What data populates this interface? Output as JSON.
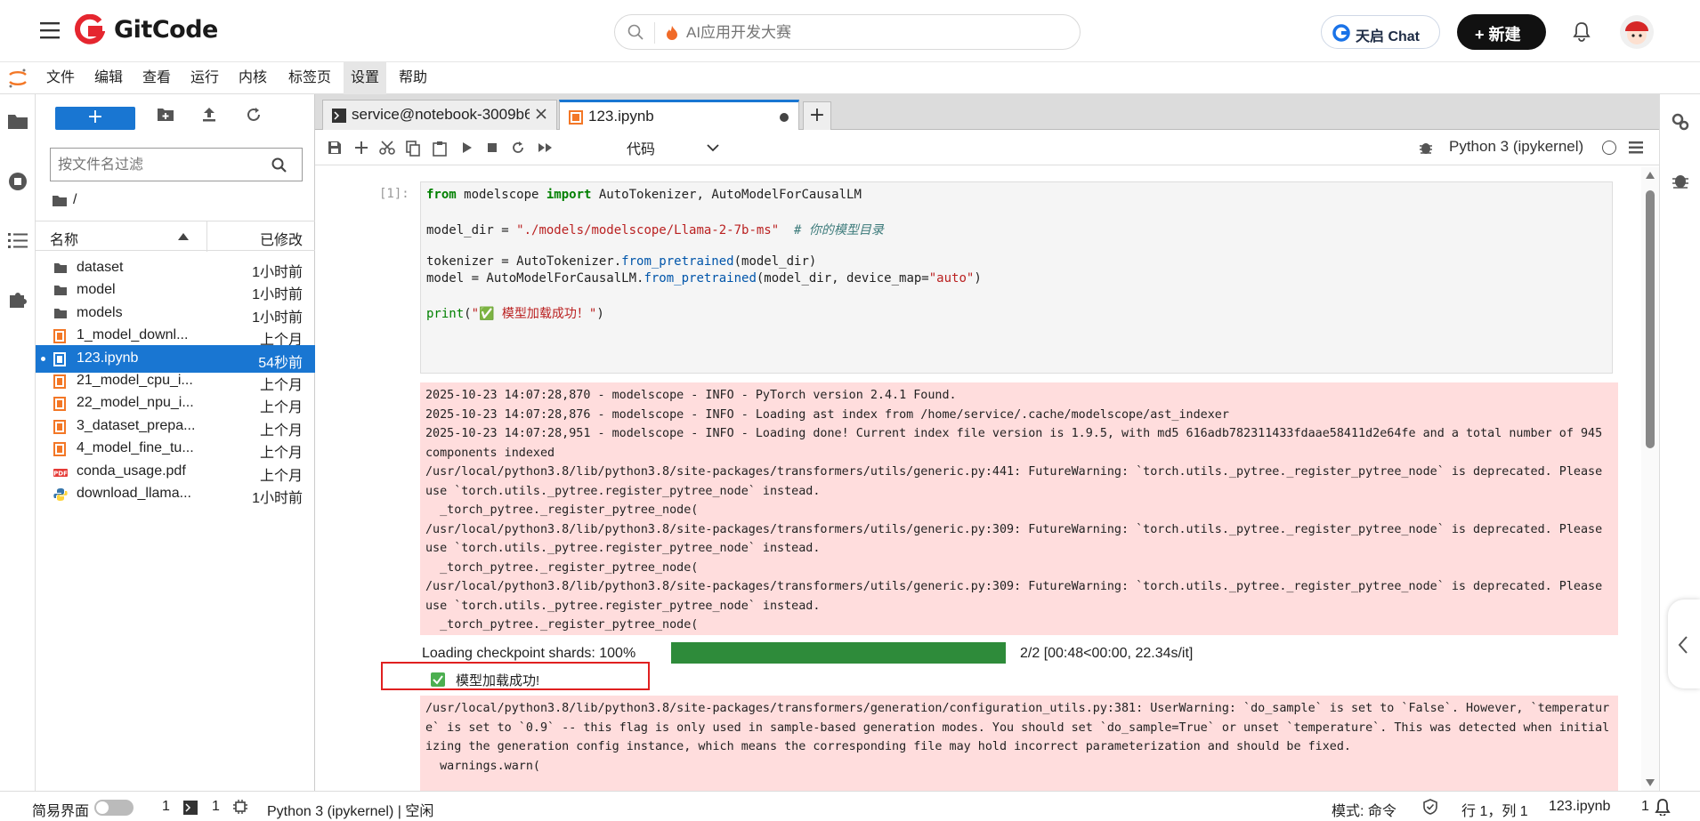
{
  "header": {
    "brand": "GitCode",
    "search_placeholder": "AI应用开发大赛",
    "chat_label": "天启 Chat",
    "new_label": "+ 新建",
    "icons": [
      "hamburger-icon",
      "gitcode-logo-icon",
      "search-icon",
      "fire-icon",
      "bell-icon",
      "avatar"
    ]
  },
  "menubar": {
    "items": [
      "文件",
      "编辑",
      "查看",
      "运行",
      "内核",
      "标签页",
      "设置",
      "帮助"
    ],
    "active_index": 6
  },
  "file_browser": {
    "new_button": "+",
    "filter_placeholder": "按文件名过滤",
    "path": "/",
    "col_name": "名称",
    "col_modified": "已修改",
    "files": [
      {
        "name": "dataset",
        "modified": "1小时前",
        "kind": "folder"
      },
      {
        "name": "model",
        "modified": "1小时前",
        "kind": "folder"
      },
      {
        "name": "models",
        "modified": "1小时前",
        "kind": "folder"
      },
      {
        "name": "1_model_downl...",
        "modified": "上个月",
        "kind": "notebook"
      },
      {
        "name": "123.ipynb",
        "modified": "54秒前",
        "kind": "notebook",
        "selected": true
      },
      {
        "name": "21_model_cpu_i...",
        "modified": "上个月",
        "kind": "notebook"
      },
      {
        "name": "22_model_npu_i...",
        "modified": "上个月",
        "kind": "notebook"
      },
      {
        "name": "3_dataset_prepa...",
        "modified": "上个月",
        "kind": "notebook"
      },
      {
        "name": "4_model_fine_tu...",
        "modified": "上个月",
        "kind": "notebook"
      },
      {
        "name": "conda_usage.pdf",
        "modified": "上个月",
        "kind": "pdf"
      },
      {
        "name": "download_llama...",
        "modified": "1小时前",
        "kind": "python"
      }
    ]
  },
  "tabs": [
    {
      "label": "service@notebook-3009b6",
      "active": false
    },
    {
      "label": "123.ipynb",
      "active": true
    }
  ],
  "toolbar": {
    "cell_type": "代码",
    "kernel": "Python 3 (ipykernel)"
  },
  "notebook": {
    "prompt": "[1]:",
    "code": {
      "l1_kw1": "from",
      "l1_a": " modelscope ",
      "l1_kw2": "import",
      "l1_b": " AutoTokenizer, AutoModelForCausalLM",
      "l2_a": "model_dir = ",
      "l2_str": "\"./models/modelscope/Llama-2-7b-ms\"",
      "l2_cm": "  # 你的模型目录",
      "l3_a": "tokenizer = AutoTokenizer.",
      "l3_fn": "from_pretrained",
      "l3_b": "(model_dir)",
      "l4_a": "model = AutoModelForCausalLM.",
      "l4_fn": "from_pretrained",
      "l4_b": "(model_dir, device_map=",
      "l4_str": "\"auto\"",
      "l4_c": ")",
      "l5_fn": "print",
      "l5_a": "(",
      "l5_str": "\"✅ 模型加载成功！\"",
      "l5_b": ")"
    },
    "stderr1": "2025-10-23 14:07:28,870 - modelscope - INFO - PyTorch version 2.4.1 Found.\n2025-10-23 14:07:28,876 - modelscope - INFO - Loading ast index from /home/service/.cache/modelscope/ast_indexer\n2025-10-23 14:07:28,951 - modelscope - INFO - Loading done! Current index file version is 1.9.5, with md5 616adb782311433fdaae58411d2e64fe and a total number of 945 components indexed\n/usr/local/python3.8/lib/python3.8/site-packages/transformers/utils/generic.py:441: FutureWarning: `torch.utils._pytree._register_pytree_node` is deprecated. Please use `torch.utils._pytree.register_pytree_node` instead.\n  _torch_pytree._register_pytree_node(\n/usr/local/python3.8/lib/python3.8/site-packages/transformers/utils/generic.py:309: FutureWarning: `torch.utils._pytree._register_pytree_node` is deprecated. Please use `torch.utils._pytree.register_pytree_node` instead.\n  _torch_pytree._register_pytree_node(\n/usr/local/python3.8/lib/python3.8/site-packages/transformers/utils/generic.py:309: FutureWarning: `torch.utils._pytree._register_pytree_node` is deprecated. Please use `torch.utils._pytree.register_pytree_node` instead.\n  _torch_pytree._register_pytree_node(",
    "progress_label": "Loading checkpoint shards: 100%",
    "progress_fraction": 1.0,
    "progress_stats": "2/2  [00:48<00:00,  22.34s/it]",
    "success_text": "模型加载成功!",
    "stderr2": "/usr/local/python3.8/lib/python3.8/site-packages/transformers/generation/configuration_utils.py:381: UserWarning: `do_sample` is set to `False`. However, `temperature` is set to `0.9` -- this flag is only used in sample-based generation modes. You should set `do_sample=True` or unset `temperature`. This was detected when initializing the generation config instance, which means the corresponding file may hold incorrect parameterization and should be fixed.\n  warnings.warn("
  },
  "status_bar": {
    "simple_mode": "简易界面",
    "count1": "1",
    "count2": "1",
    "kernel_status": "Python 3 (ipykernel) | 空闲",
    "mode": "模式: 命令",
    "position": "行 1，列 1",
    "file": "123.ipynb",
    "notifications": "1"
  },
  "colors": {
    "accent": "#1976d2",
    "stderr_bg": "#ffdddd",
    "progress": "#2e8b3a",
    "highlight": "#e02020"
  }
}
